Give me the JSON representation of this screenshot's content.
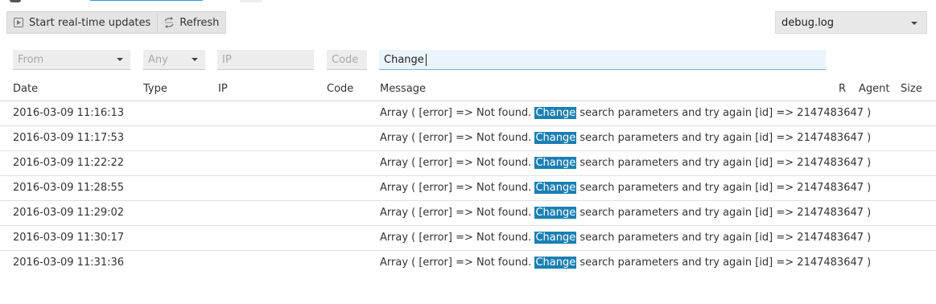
{
  "toolbar": {
    "realtime_label": "Start real-time updates",
    "refresh_label": "Refresh",
    "log_file": "debug.log"
  },
  "filters": {
    "from_placeholder": "From",
    "type_placeholder": "Any",
    "ip_placeholder": "IP",
    "code_placeholder": "Code",
    "message_value": "Change"
  },
  "table": {
    "headers": {
      "date": "Date",
      "type": "Type",
      "ip": "IP",
      "code": "Code",
      "message": "Message",
      "r": "R",
      "agent": "Agent",
      "size": "Size"
    },
    "rows": [
      {
        "date": "2016-03-09 11:16:13",
        "msg_before": "Array ( [error] => Not found. ",
        "msg_highlight": "Change",
        "msg_after": " search parameters and try again [id] => 2147483647 )"
      },
      {
        "date": "2016-03-09 11:17:53",
        "msg_before": "Array ( [error] => Not found. ",
        "msg_highlight": "Change",
        "msg_after": " search parameters and try again [id] => 2147483647 )"
      },
      {
        "date": "2016-03-09 11:22:22",
        "msg_before": "Array ( [error] => Not found. ",
        "msg_highlight": "Change",
        "msg_after": " search parameters and try again [id] => 2147483647 )"
      },
      {
        "date": "2016-03-09 11:28:55",
        "msg_before": "Array ( [error] => Not found. ",
        "msg_highlight": "Change",
        "msg_after": " search parameters and try again [id] => 2147483647 )"
      },
      {
        "date": "2016-03-09 11:29:02",
        "msg_before": "Array ( [error] => Not found. ",
        "msg_highlight": "Change",
        "msg_after": " search parameters and try again [id] => 2147483647 )"
      },
      {
        "date": "2016-03-09 11:30:17",
        "msg_before": "Array ( [error] => Not found. ",
        "msg_highlight": "Change",
        "msg_after": " search parameters and try again [id] => 2147483647 )"
      },
      {
        "date": "2016-03-09 11:31:36",
        "msg_before": "Array ( [error] => Not found. ",
        "msg_highlight": "Change",
        "msg_after": " search parameters and try again [id] => 2147483647 )"
      }
    ]
  },
  "colors": {
    "highlight": "#1a7fb3",
    "search_focus_bg": "#eaf4fb"
  },
  "icons": {
    "realtime": "play-icon",
    "refresh": "refresh-icon",
    "dropdown": "chevron-down-icon"
  }
}
